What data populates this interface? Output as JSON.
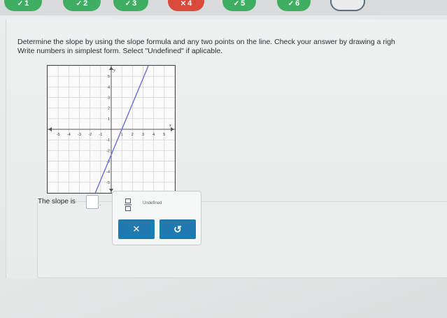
{
  "progress": {
    "items": [
      {
        "label": "1",
        "state": "correct",
        "mark": "✓"
      },
      {
        "label": "2",
        "state": "correct",
        "mark": "✓"
      },
      {
        "label": "3",
        "state": "correct",
        "mark": "✓"
      },
      {
        "label": "4",
        "state": "incorrect",
        "mark": "✕"
      },
      {
        "label": "5",
        "state": "correct",
        "mark": "✓"
      },
      {
        "label": "6",
        "state": "correct",
        "mark": "✓"
      },
      {
        "label": "",
        "state": "current",
        "mark": ""
      }
    ]
  },
  "question": {
    "line1": "Determine the slope by using the slope formula and any two points on the line. Check your answer by drawing a righ",
    "line2": "Write numbers in simplest form. Select \"Undefined\" if aplicable."
  },
  "graph": {
    "x_axis_label": "x",
    "y_axis_label": "y",
    "x_ticks": [
      "-5",
      "-4",
      "-3",
      "-2",
      "-1",
      "1",
      "2",
      "3",
      "4",
      "5"
    ],
    "y_ticks": [
      "5",
      "4",
      "3",
      "2",
      "1",
      "-1",
      "-2",
      "-3",
      "-4",
      "-5"
    ],
    "xlim": [
      -6,
      6
    ],
    "ylim": [
      -6,
      6
    ],
    "line": {
      "x1": -1.5,
      "y1": -6,
      "x2": 3.5,
      "y2": 6
    },
    "line_color": "#6a6fd0"
  },
  "answer": {
    "prompt": "The slope is",
    "period": ".",
    "undefined_label": "Undefined",
    "clear_symbol": "✕",
    "reset_symbol": "↺"
  },
  "colors": {
    "correct": "#3fae63",
    "incorrect": "#d84a3a",
    "button": "#1f7ab0"
  }
}
